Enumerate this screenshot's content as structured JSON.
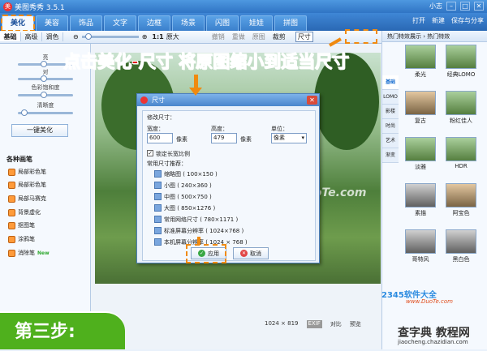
{
  "app": {
    "title": "美图秀秀 3.5.1",
    "user": "小志",
    "min": "–",
    "max": "□",
    "close": "✕"
  },
  "menu": {
    "tabs": [
      "美化",
      "美容",
      "饰品",
      "文字",
      "边框",
      "场景",
      "闪图",
      "娃娃",
      "拼图"
    ],
    "open": "打开",
    "new": "新建",
    "save": "保存与分享"
  },
  "toolbar": {
    "sub_tabs": [
      "基础",
      "高级",
      "调色"
    ],
    "ratio": "1:1",
    "orig_size": "原大",
    "undo": "撤销",
    "redo": "重做",
    "original": "原图",
    "crop": "裁剪",
    "resize": "尺寸"
  },
  "left": {
    "labels": [
      "亮",
      "对",
      "色彩饱和度",
      "清晰度"
    ],
    "one_key": "一键美化",
    "brush_title": "各种画笔",
    "brushes": [
      "局部彩色笔",
      "局部彩色笔",
      "局部马赛克",
      "背景虚化",
      "抠图笔",
      "涂鸦笔",
      "消除笔"
    ],
    "new_tag": "New"
  },
  "right": {
    "head": "热门特效展示 › 热门特效",
    "tabs": [
      "基础",
      "LOMO",
      "影楼",
      "时尚",
      "艺术",
      "渐变"
    ],
    "thumbs": [
      "柔光",
      "经典LOMO",
      "复古",
      "粉红佳人",
      "淡雅",
      "HDR",
      "素描",
      "阿宝色",
      "哥特风",
      "黑白色"
    ]
  },
  "dialog": {
    "title": "尺寸",
    "section": "修改尺寸：",
    "width_label": "宽度：",
    "width": "600",
    "px1": "像素",
    "height_label": "高度：",
    "height": "479",
    "px2": "像素",
    "unit_label": "单位：",
    "unit": "像素",
    "lock": "锁定长宽比例",
    "presets_title": "常用尺寸推荐：",
    "presets": [
      "缩略图 ( 100×150 )",
      "小图 ( 240×360 )",
      "中图 ( 500×750 )",
      "大图 ( 850×1276 )",
      "常用网络尺寸 ( 780×1171 )",
      "标准屏幕分辨率 ( 1024×768 )",
      "本机屏幕分辨率 ( 1024 × 768 )"
    ],
    "apply": "应用",
    "cancel": "取消"
  },
  "canvas": {
    "size": "1024 × 819",
    "exif": "EXIF",
    "compare": "对比",
    "preview": "预览"
  },
  "annotations": {
    "banner": "点击美化-尺寸 将原图缩小到适当尺寸",
    "step": "第三步:",
    "watermark": "www.DuoTe.com"
  },
  "branding": {
    "brand": "2345软件大全",
    "brand_url": "www.DuoTe.com",
    "site": "查字典 教程网",
    "site_url": "jiaocheng.chazidian.com"
  },
  "colors": {
    "accent": "#f08a10",
    "banner": "#e0180c",
    "step_bg": "#4fb01d",
    "title_blue": "#2f74c4"
  }
}
